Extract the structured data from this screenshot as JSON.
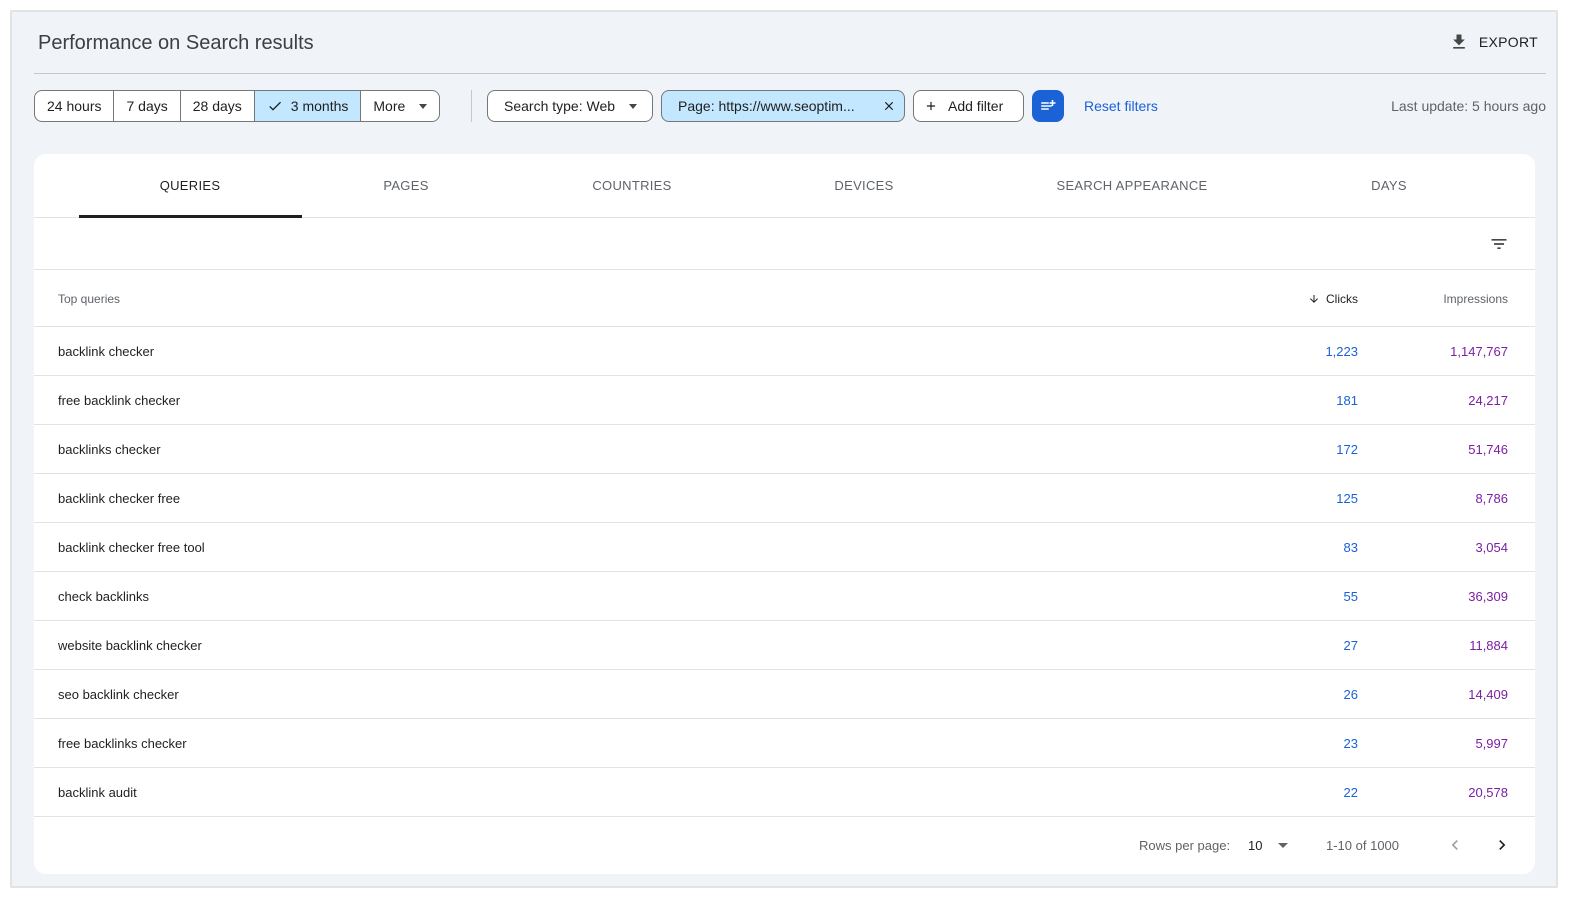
{
  "header": {
    "title": "Performance on Search results",
    "export_label": "EXPORT"
  },
  "date_range": {
    "options": [
      "24 hours",
      "7 days",
      "28 days",
      "3 months",
      "More"
    ],
    "selected": "3 months"
  },
  "filters": {
    "search_type": "Search type: Web",
    "page": "Page: https://www.seoptim...",
    "add_filter": "Add filter",
    "reset": "Reset filters",
    "last_update": "Last update: 5 hours ago"
  },
  "tabs": [
    "QUERIES",
    "PAGES",
    "COUNTRIES",
    "DEVICES",
    "SEARCH APPEARANCE",
    "DAYS"
  ],
  "active_tab": "QUERIES",
  "table": {
    "columns": {
      "query": "Top queries",
      "clicks": "Clicks",
      "impressions": "Impressions"
    },
    "sort": "Clicks descending",
    "rows": [
      {
        "query": "backlink checker",
        "clicks": "1,223",
        "impressions": "1,147,767"
      },
      {
        "query": "free backlink checker",
        "clicks": "181",
        "impressions": "24,217"
      },
      {
        "query": "backlinks checker",
        "clicks": "172",
        "impressions": "51,746"
      },
      {
        "query": "backlink checker free",
        "clicks": "125",
        "impressions": "8,786"
      },
      {
        "query": "backlink checker free tool",
        "clicks": "83",
        "impressions": "3,054"
      },
      {
        "query": "check backlinks",
        "clicks": "55",
        "impressions": "36,309"
      },
      {
        "query": "website backlink checker",
        "clicks": "27",
        "impressions": "11,884"
      },
      {
        "query": "seo backlink checker",
        "clicks": "26",
        "impressions": "14,409"
      },
      {
        "query": "free backlinks checker",
        "clicks": "23",
        "impressions": "5,997"
      },
      {
        "query": "backlink audit",
        "clicks": "22",
        "impressions": "20,578"
      }
    ]
  },
  "pagination": {
    "rows_per_page_label": "Rows per page:",
    "rows_per_page": "10",
    "range": "1-10 of 1000"
  },
  "colors": {
    "accent": "#1a62d6",
    "selected_chip": "#c2e7ff",
    "impressions": "#7b1fa2",
    "background": "#f0f4f9"
  },
  "icons": {
    "export": "download-icon",
    "selected": "check-icon",
    "remove_filter": "close-icon",
    "add": "plus-icon",
    "filter_settings": "tune-icon",
    "table_filter": "filter-list-icon",
    "sort": "arrow-down-icon",
    "prev": "chevron-left-icon",
    "next": "chevron-right-icon"
  }
}
